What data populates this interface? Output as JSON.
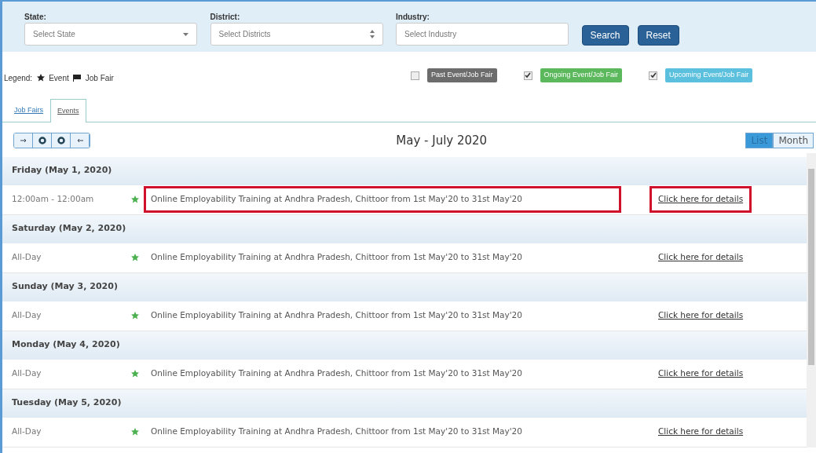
{
  "filters": [
    {
      "label": "State:",
      "placeholder": "Select State",
      "kind": "select"
    },
    {
      "label": "District:",
      "placeholder": "Select Districts",
      "kind": "spinner"
    },
    {
      "label": "Industry:",
      "placeholder": "Select Industry",
      "kind": "text"
    }
  ],
  "buttons": [
    "Search",
    "Reset"
  ],
  "legend": {
    "label": "Legend:",
    "items": [
      {
        "kind": "star",
        "label": "Event"
      },
      {
        "kind": "flag",
        "label": "Job Fair"
      }
    ]
  },
  "status_filters": [
    {
      "label": "Past Event/Job Fair",
      "checked": false,
      "color": "#6c6c6c"
    },
    {
      "label": "Ongoing Event/Job Fair",
      "checked": true,
      "color": "#5cb85c"
    },
    {
      "label": "Upcoming Event/Job Fair",
      "checked": true,
      "color": "#5bc0de"
    }
  ],
  "tabs": [
    {
      "label": "Job Fairs",
      "selected": false
    },
    {
      "label": "Events",
      "selected": true
    }
  ],
  "nav_buttons": [
    {
      "kind": "prev"
    },
    {
      "kind": "circle"
    },
    {
      "kind": "circle"
    },
    {
      "kind": "next"
    }
  ],
  "range_title": "May - July 2020",
  "views": [
    {
      "label": "List",
      "selected": true
    },
    {
      "label": "Month",
      "selected": false
    }
  ],
  "days": [
    {
      "date": "Friday (May 1, 2020)",
      "events": [
        {
          "time": "12:00am - 12:00am",
          "title": "Online Employability Training at Andhra Pradesh, Chittoor from 1st May'20 to 31st May'20",
          "link": "Click here for details",
          "highlighted": true
        }
      ]
    },
    {
      "date": "Saturday (May 2, 2020)",
      "events": [
        {
          "time": "All-Day",
          "title": "Online Employability Training at Andhra Pradesh, Chittoor from 1st May'20 to 31st May'20",
          "link": "Click here for details",
          "highlighted": false
        }
      ]
    },
    {
      "date": "Sunday (May 3, 2020)",
      "events": [
        {
          "time": "All-Day",
          "title": "Online Employability Training at Andhra Pradesh, Chittoor from 1st May'20 to 31st May'20",
          "link": "Click here for details",
          "highlighted": false
        }
      ]
    },
    {
      "date": "Monday (May 4, 2020)",
      "events": [
        {
          "time": "All-Day",
          "title": "Online Employability Training at Andhra Pradesh, Chittoor from 1st May'20 to 31st May'20",
          "link": "Click here for details",
          "highlighted": false
        }
      ]
    },
    {
      "date": "Tuesday (May 5, 2020)",
      "events": [
        {
          "time": "All-Day",
          "title": "Online Employability Training at Andhra Pradesh, Chittoor from 1st May'20 to 31st May'20",
          "link": "Click here for details",
          "highlighted": false
        }
      ]
    }
  ]
}
